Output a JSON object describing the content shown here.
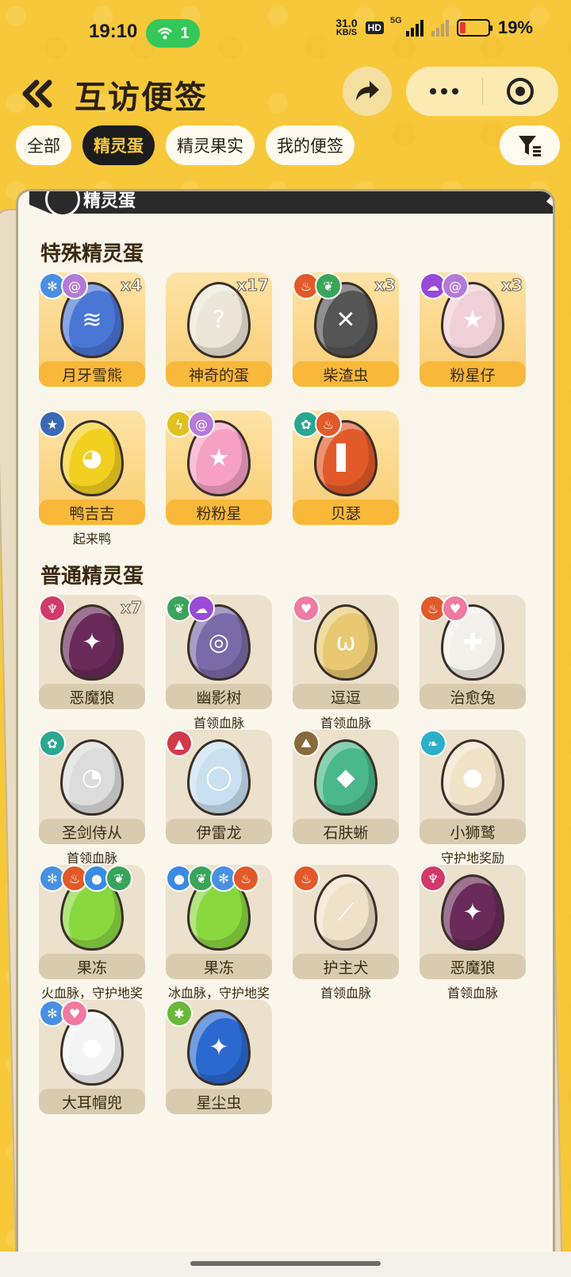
{
  "status_bar": {
    "time": "19:10",
    "hotspot_count": "1",
    "net_speed_value": "31.0",
    "net_speed_unit": "KB/S",
    "hd_label": "HD",
    "network_label": "5G",
    "battery_percent": "19%"
  },
  "header": {
    "title": "互访便签",
    "back_icon": "double-chevron-left-icon",
    "share_icon": "share-arrow-icon"
  },
  "tabs": [
    {
      "label": "全部",
      "active": false
    },
    {
      "label": "精灵蛋",
      "active": true
    },
    {
      "label": "精灵果实",
      "active": false
    },
    {
      "label": "我的便签",
      "active": false
    }
  ],
  "card": {
    "ribbon_title": "精灵蛋"
  },
  "special_section": {
    "title": "特殊精灵蛋",
    "items": [
      {
        "name": "月牙雪熊",
        "count": "x4",
        "sub": "",
        "badges": [
          {
            "icon": "snowflake-icon",
            "color": "#4a90e2"
          },
          {
            "icon": "spiral-icon",
            "color": "#b47ad8"
          }
        ],
        "egg_color": "#4a76d6",
        "mark": "≋"
      },
      {
        "name": "神奇的蛋",
        "count": "x17",
        "sub": "",
        "badges": [],
        "egg_color": "#ece6d8",
        "mark": "?"
      },
      {
        "name": "柴渣虫",
        "count": "x3",
        "sub": "",
        "badges": [
          {
            "icon": "fire-icon",
            "color": "#e25a2a"
          },
          {
            "icon": "leaf-icon",
            "color": "#3aa55a"
          }
        ],
        "egg_color": "#555555",
        "mark": "✕"
      },
      {
        "name": "粉星仔",
        "count": "x3",
        "sub": "",
        "badges": [
          {
            "icon": "ghost-icon",
            "color": "#9a4ad6"
          },
          {
            "icon": "spiral-icon",
            "color": "#b47ad8"
          }
        ],
        "egg_color": "#f0d0d8",
        "mark": "★"
      },
      {
        "name": "鸭吉吉",
        "count": "",
        "sub": "起来鸭",
        "badges": [
          {
            "icon": "star-circle-icon",
            "color": "#3a6ab4"
          }
        ],
        "egg_color": "#f2d020",
        "mark": "◕"
      },
      {
        "name": "粉粉星",
        "count": "",
        "sub": "",
        "badges": [
          {
            "icon": "lightning-icon",
            "color": "#e2c020"
          },
          {
            "icon": "spiral-icon",
            "color": "#b47ad8"
          }
        ],
        "egg_color": "#f6a0c4",
        "mark": "★"
      },
      {
        "name": "贝瑟",
        "count": "",
        "sub": "",
        "badges": [
          {
            "icon": "gear-icon",
            "color": "#2aa890"
          },
          {
            "icon": "fire-icon",
            "color": "#e25a2a"
          }
        ],
        "egg_color": "#e25a2a",
        "mark": "▌"
      }
    ]
  },
  "normal_section": {
    "title": "普通精灵蛋",
    "items": [
      {
        "name": "恶魔狼",
        "count": "x7",
        "sub": "",
        "badges": [
          {
            "icon": "demon-icon",
            "color": "#d23a6a"
          }
        ],
        "egg_color": "#6a2a5a",
        "mark": "✦"
      },
      {
        "name": "幽影树",
        "count": "",
        "sub": "首领血脉",
        "badges": [
          {
            "icon": "leaf-icon",
            "color": "#3aa55a"
          },
          {
            "icon": "ghost-icon",
            "color": "#9a4ad6"
          }
        ],
        "egg_color": "#7a6aa8",
        "mark": "◎"
      },
      {
        "name": "逗逗",
        "count": "",
        "sub": "首领血脉",
        "badges": [
          {
            "icon": "heart-icon",
            "color": "#f07aa0"
          }
        ],
        "egg_color": "#e8c870",
        "mark": "ω"
      },
      {
        "name": "治愈兔",
        "count": "",
        "sub": "",
        "badges": [
          {
            "icon": "fire-icon",
            "color": "#e25a2a"
          },
          {
            "icon": "heart-icon",
            "color": "#f07aa0"
          }
        ],
        "egg_color": "#f2f0ea",
        "mark": "✚"
      },
      {
        "name": "圣剑侍从",
        "count": "",
        "sub": "首领血脉",
        "badges": [
          {
            "icon": "gear-icon",
            "color": "#2aa890"
          }
        ],
        "egg_color": "#dcdcdc",
        "mark": "◔"
      },
      {
        "name": "伊雷龙",
        "count": "",
        "sub": "",
        "badges": [
          {
            "icon": "dragon-icon",
            "color": "#d23a4a"
          }
        ],
        "egg_color": "#c8e0f0",
        "mark": "◯"
      },
      {
        "name": "石肤蜥",
        "count": "",
        "sub": "",
        "badges": [
          {
            "icon": "mountain-icon",
            "color": "#8a6a3a"
          }
        ],
        "egg_color": "#4ab88a",
        "mark": "◆"
      },
      {
        "name": "小狮鹫",
        "count": "",
        "sub": "守护地奖励",
        "badges": [
          {
            "icon": "wing-icon",
            "color": "#2ab0c8"
          }
        ],
        "egg_color": "#f2e2c8",
        "mark": "●"
      },
      {
        "name": "果冻",
        "count": "",
        "sub": "火血脉，守护地奖",
        "badges": [
          {
            "icon": "snowflake-icon",
            "color": "#4a90e2"
          },
          {
            "icon": "fire-icon",
            "color": "#e25a2a"
          },
          {
            "icon": "water-drop-icon",
            "color": "#3a8ae2"
          },
          {
            "icon": "leaf-icon",
            "color": "#3aa55a"
          }
        ],
        "egg_color": "#8ad840",
        "mark": ""
      },
      {
        "name": "果冻",
        "count": "",
        "sub": "冰血脉，守护地奖",
        "badges": [
          {
            "icon": "water-drop-icon",
            "color": "#3a8ae2"
          },
          {
            "icon": "leaf-icon",
            "color": "#3aa55a"
          },
          {
            "icon": "snowflake-icon",
            "color": "#4a90e2"
          },
          {
            "icon": "fire-icon",
            "color": "#e25a2a"
          }
        ],
        "egg_color": "#8ad840",
        "mark": ""
      },
      {
        "name": "护主犬",
        "count": "",
        "sub": "首领血脉",
        "badges": [
          {
            "icon": "fire-icon",
            "color": "#e25a2a"
          }
        ],
        "egg_color": "#f0e2c8",
        "mark": "⟋"
      },
      {
        "name": "恶魔狼",
        "count": "",
        "sub": "首领血脉",
        "badges": [
          {
            "icon": "demon-icon",
            "color": "#d23a6a"
          }
        ],
        "egg_color": "#6a2a5a",
        "mark": "✦"
      },
      {
        "name": "大耳帽兜",
        "count": "",
        "sub": "",
        "badges": [
          {
            "icon": "snowflake-icon",
            "color": "#4a90e2"
          },
          {
            "icon": "heart-icon",
            "color": "#f07aa0"
          }
        ],
        "egg_color": "#f4f4f4",
        "mark": "●"
      },
      {
        "name": "星尘虫",
        "count": "",
        "sub": "",
        "badges": [
          {
            "icon": "bug-icon",
            "color": "#6ab83a"
          }
        ],
        "egg_color": "#2a6ad0",
        "mark": "✦"
      }
    ]
  }
}
